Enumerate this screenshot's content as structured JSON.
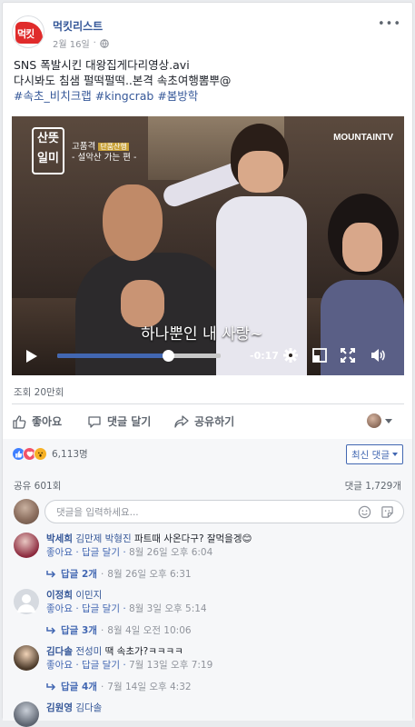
{
  "post": {
    "page_name": "먹킷리스트",
    "logo_text": "먹킷",
    "date": "2월 16일",
    "privacy_sep": "·",
    "more": "•••",
    "text_line1": "SNS 폭발시킨 대왕집게다리영상.avi",
    "text_line2": "다시봐도 침샘 펄떡펄떡..본격 속초여행뽐뿌@",
    "hashtags": "#속초_비치크랩 #kingcrab #봄방학"
  },
  "video": {
    "logo": "산뜻\n일미",
    "subtitle_line1": "고품격",
    "subtitle_badge": "단품산행",
    "subtitle_line2": "- 설악산 가는 편 -",
    "channel": "MOUNTAINTV",
    "caption": "하나뿐인 내 사랑~",
    "time_remaining": "-0:17",
    "progress_fraction": 0.68
  },
  "stats": {
    "views": "조회 20만회"
  },
  "actions": {
    "like": "좋아요",
    "comment": "댓글 달기",
    "share": "공유하기"
  },
  "reactions": {
    "count": "6,113명",
    "sort": "최신 댓글",
    "shares": "공유 601회",
    "comments": "댓글 1,729개"
  },
  "comment_input": {
    "placeholder": "댓글을 입력하세요..."
  },
  "comments": [
    {
      "name": "박세희",
      "mention": "김만제 박형진",
      "text": "파트때 사온다구? 잘먹을겡😊",
      "like": "좋아요",
      "reply": "답글 달기",
      "date": "8월 26일 오후 6:04",
      "replies": "답글 2개",
      "reply_date": "8월 26일 오후 6:31"
    },
    {
      "name": "이정희",
      "mention": "이민지",
      "text": "",
      "like": "좋아요",
      "reply": "답글 달기",
      "date": "8월 3일 오후 5:14",
      "replies": "답글 3개",
      "reply_date": "8월 4일 오전 10:06"
    },
    {
      "name": "김다솔",
      "mention": "전성미",
      "text": "땍 속초가?ㅋㅋㅋㅋ",
      "like": "좋아요",
      "reply": "답글 달기",
      "date": "7월 13일 오후 7:19",
      "replies": "답글 4개",
      "reply_date": "7월 14일 오후 4:32"
    },
    {
      "name": "김원영",
      "mention": "김다솔",
      "text": ""
    }
  ]
}
